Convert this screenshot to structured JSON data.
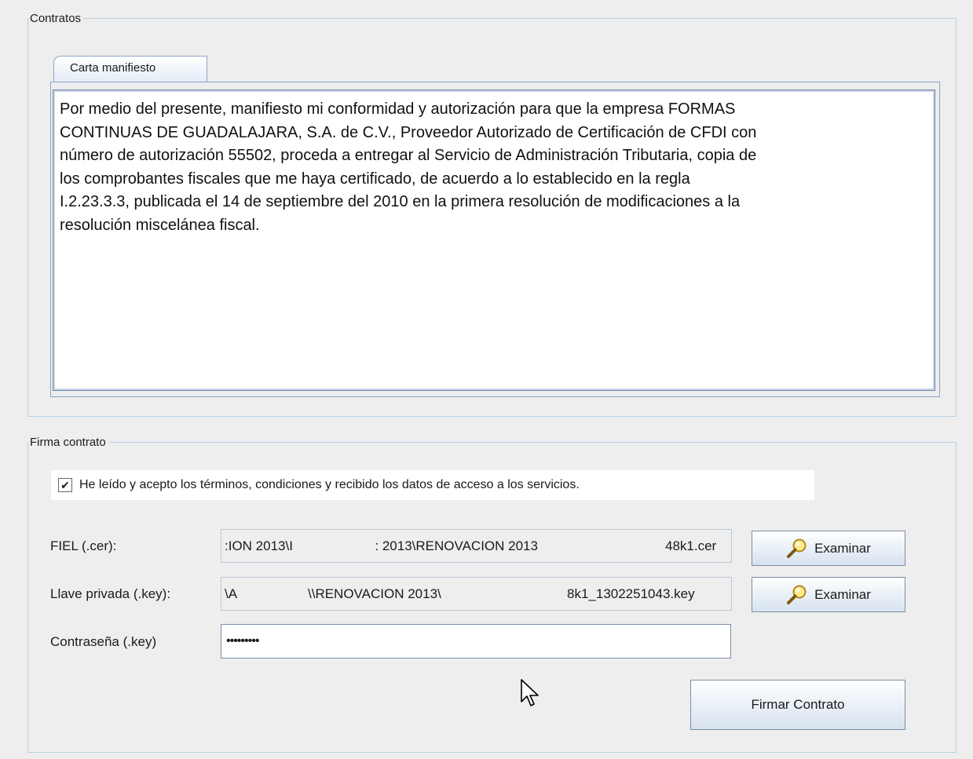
{
  "contratos": {
    "legend": "Contratos",
    "tab_label": "Carta manifiesto",
    "text_lines": [
      "Por medio del presente, manifiesto mi conformidad y autorización para que la empresa FORMAS",
      "CONTINUAS DE GUADALAJARA, S.A. de C.V., Proveedor Autorizado de Certificación de CFDI con",
      "número de autorización 55502, proceda a entregar al Servicio de Administración Tributaria, copia de",
      "los comprobantes fiscales que me haya certificado, de acuerdo a lo establecido en la regla",
      "I.2.23.3.3, publicada el 14 de septiembre del 2010 en la primera resolución de modificaciones a la",
      "resolución miscelánea fiscal."
    ]
  },
  "firma": {
    "legend": "Firma contrato",
    "accept_checked": true,
    "accept_check_glyph": "✔",
    "accept_label": "He leído y acepto los términos, condiciones y recibido los datos de acceso a los servicios.",
    "fiel": {
      "label": "FIEL (.cer):",
      "segments": [
        ":ION 2013\\I",
        " : 2013\\RENOVACION 2013",
        "48k1.cer"
      ]
    },
    "key": {
      "label": "Llave privada (.key):",
      "segments": [
        "\\A",
        "\\\\RENOVACION 2013\\",
        "8k1_1302251043.key"
      ]
    },
    "password": {
      "label": "Contraseña (.key)",
      "value": "•••••••••"
    },
    "browse_label": "Examinar",
    "sign_label": "Firmar Contrato"
  },
  "icons": {
    "browse": "magnifier-icon",
    "cursor": "mouse-pointer-icon"
  }
}
